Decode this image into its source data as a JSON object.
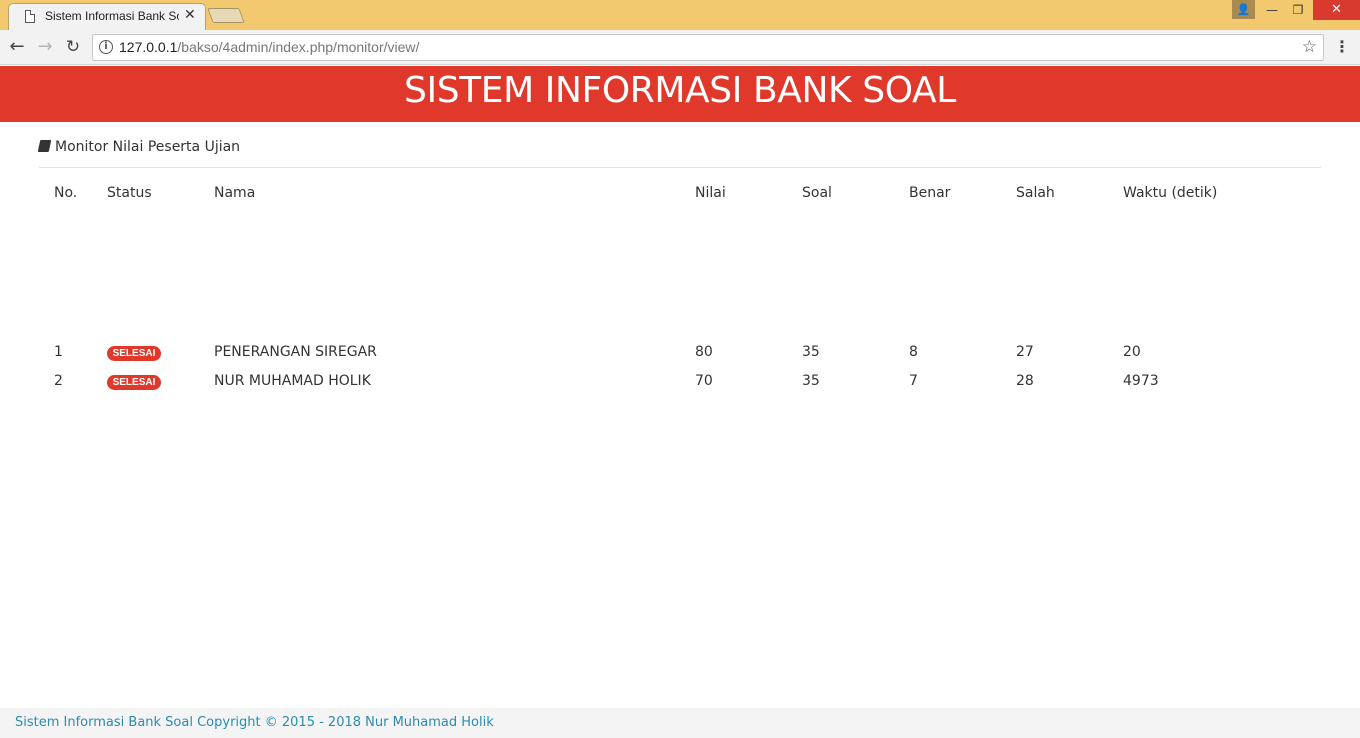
{
  "browser": {
    "tab_title": "Sistem Informasi Bank Soal",
    "tab_close": "✕",
    "url_host": "127.0.0.1",
    "url_path": "/bakso/4admin/index.php/monitor/view/",
    "window_buttons": {
      "user": "👤",
      "minimize": "—",
      "maximize": "❐",
      "close": "✕"
    }
  },
  "header": {
    "title": "SISTEM INFORMASI BANK SOAL"
  },
  "section": {
    "title": "Monitor Nilai Peserta Ujian"
  },
  "table": {
    "columns": [
      "No.",
      "Status",
      "Nama",
      "Nilai",
      "Soal",
      "Benar",
      "Salah",
      "Waktu (detik)"
    ],
    "rows": [
      {
        "no": "1",
        "status": "SELESAI",
        "nama": "PENERANGAN SIREGAR",
        "nilai": "80",
        "soal": "35",
        "benar": "8",
        "salah": "27",
        "waktu": "20"
      },
      {
        "no": "2",
        "status": "SELESAI",
        "nama": "NUR MUHAMAD HOLIK",
        "nilai": "70",
        "soal": "35",
        "benar": "7",
        "salah": "28",
        "waktu": "4973"
      }
    ]
  },
  "footer": {
    "text": "Sistem Informasi Bank Soal Copyright © 2015 - 2018 Nur Muhamad Holik"
  },
  "colors": {
    "brand_red": "#e0392b",
    "titlebar": "#f3c970",
    "footer_link": "#2b8bb0"
  }
}
